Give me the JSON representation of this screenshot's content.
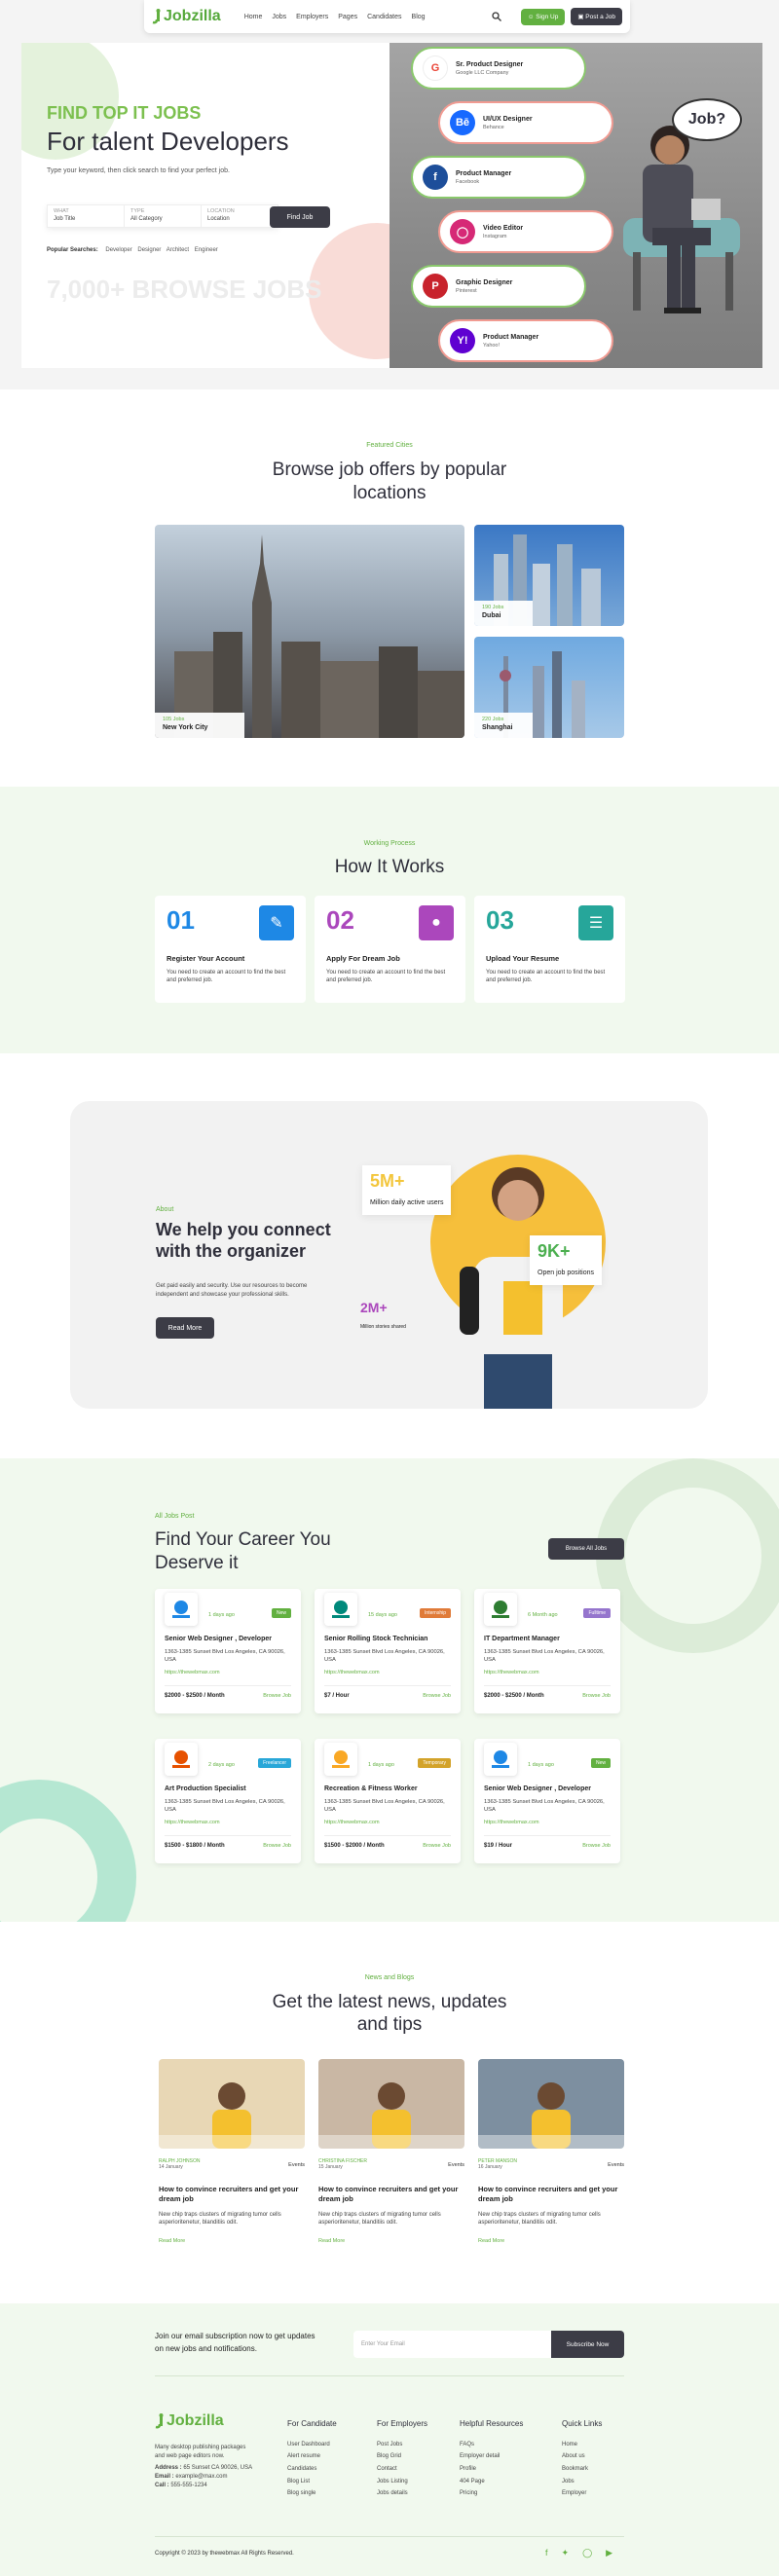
{
  "nav": {
    "logo": "Jobzilla",
    "menu": [
      "Home",
      "Jobs",
      "Employers",
      "Pages",
      "Candidates",
      "Blog"
    ],
    "signup": "Sign Up",
    "post_job": "Post a Job"
  },
  "hero": {
    "kicker": "FIND TOP IT JOBS",
    "title": "For talent Developers",
    "subtitle": "Type your keyword, then click search to find your perfect job.",
    "search": {
      "what_label": "WHAT",
      "what_value": "Job Title",
      "type_label": "TYPE",
      "type_value": "All Category",
      "location_label": "LOCATION",
      "location_value": "Location",
      "button": "Find Job"
    },
    "popular_label": "Popular Searches:",
    "popular": [
      "Developer",
      "Designer",
      "Architect",
      "Engineer"
    ],
    "browse": "7,000+ BROWSE JOBS",
    "bubble": "Job?",
    "cards": [
      {
        "title": "Sr. Product Designer",
        "company": "Google LLC Company",
        "color": "#ffffff"
      },
      {
        "title": "UI/UX Designer",
        "company": "Behance",
        "color": "#1769ff"
      },
      {
        "title": "Product Manager",
        "company": "Facebook",
        "color": "#1d4e9a"
      },
      {
        "title": "Video Editor",
        "company": "Instagram",
        "color": "#d62976"
      },
      {
        "title": "Graphic Designer",
        "company": "Pinterest",
        "color": "#c8232c"
      },
      {
        "title": "Product Manager",
        "company": "Yahoo!",
        "color": "#5f01d1"
      }
    ]
  },
  "cities": {
    "kicker": "Featured Cities",
    "title_l1": "Browse job offers by popular",
    "title_l2": "locations",
    "items": [
      {
        "count": "105 Jobs",
        "name": "New York City"
      },
      {
        "count": "190 Jobs",
        "name": "Dubai"
      },
      {
        "count": "220 Jobs",
        "name": "Shanghai"
      }
    ]
  },
  "how": {
    "kicker": "Working Process",
    "title": "How It Works",
    "steps": [
      {
        "num": "01",
        "title": "Register Your Account",
        "desc": "You need to create an account to find the best and preferred job.",
        "color": "#1e88e5"
      },
      {
        "num": "02",
        "title": "Apply For Dream Job",
        "desc": "You need to create an account to find the best and preferred job.",
        "color": "#ab47bc"
      },
      {
        "num": "03",
        "title": "Upload Your Resume",
        "desc": "You need to create an account to find the best and preferred job.",
        "color": "#26a69a"
      }
    ]
  },
  "about": {
    "kicker": "About",
    "title_l1": "We help you connect",
    "title_l2": "with the organizer",
    "desc_l1": "Get paid easily and security. Use our resources to become",
    "desc_l2": "independent and showcase your professional skills.",
    "button": "Read More",
    "stats": [
      {
        "value": "5M+",
        "label": "Million daily active users"
      },
      {
        "value": "9K+",
        "label": "Open job positions"
      },
      {
        "value": "2M+",
        "label": "Million stories shared"
      }
    ]
  },
  "career": {
    "kicker": "All Jobs Post",
    "title_l1": "Find Your Career You",
    "title_l2": "Deserve it",
    "browse_all": "Browse All Jobs",
    "jobs": [
      {
        "date": "1 days ago",
        "tag": "New",
        "tag_color": "#62b040",
        "title": "Senior Web Designer , Developer",
        "address": "1363-1385 Sunset Blvd Los Angeles, CA 90026, USA",
        "link": "https://thewebmax.com",
        "price": "$2000 - $2500 / Month",
        "logo_color": "#1e88e5",
        "logo_text": "COMPANY"
      },
      {
        "date": "15 days ago",
        "tag": "Internship",
        "tag_color": "#e07b39",
        "title": "Senior Rolling Stock Technician",
        "address": "1363-1385 Sunset Blvd Los Angeles, CA 90026, USA",
        "link": "https://thewebmax.com",
        "price": "$7 / Hour",
        "logo_color": "#00897b",
        "logo_text": "BUSINESS"
      },
      {
        "date": "6 Month ago",
        "tag": "Fulltime",
        "tag_color": "#9575cd",
        "title": "IT Department Manager",
        "address": "1363-1385 Sunset Blvd Los Angeles, CA 90026, USA",
        "link": "https://thewebmax.com",
        "price": "$2000 - $2500 / Month",
        "logo_color": "#2e7d32",
        "logo_text": "FASHION"
      },
      {
        "date": "2 days ago",
        "tag": "Freelancer",
        "tag_color": "#29a7d8",
        "title": "Art Production Specialist",
        "address": "1363-1385 Sunset Blvd Los Angeles, CA 90026, USA",
        "link": "https://thewebmax.com",
        "price": "$1500 - $1800 / Month",
        "logo_color": "#e65100",
        "logo_text": "ARROW"
      },
      {
        "date": "1 days ago",
        "tag": "Temporary",
        "tag_color": "#d3a32a",
        "title": "Recreation & Fitness Worker",
        "address": "1363-1385 Sunset Blvd Los Angeles, CA 90026, USA",
        "link": "https://thewebmax.com",
        "price": "$1500 - $2000 / Month",
        "logo_color": "#f9a825",
        "logo_text": "MEDIA"
      },
      {
        "date": "1 days ago",
        "tag": "New",
        "tag_color": "#62b040",
        "title": "Senior Web Designer , Developer",
        "address": "1363-1385 Sunset Blvd Los Angeles, CA 90026, USA",
        "link": "https://thewebmax.com",
        "price": "$19 / Hour",
        "logo_color": "#1e88e5",
        "logo_text": "COMPANY"
      }
    ],
    "browse_job": "Browse Job"
  },
  "blog": {
    "kicker": "News and Blogs",
    "title_l1": "Get the latest news, updates",
    "title_l2": "and tips",
    "posts": [
      {
        "author": "RALPH JOHNSON",
        "date": "14 January",
        "category": "Events",
        "title": "How to convince recruiters and get your dream job",
        "desc": "New chip traps clusters of migrating tumor cells asperioritenetur, blanditiis odit.",
        "read": "Read More",
        "color": "#e8d7b5"
      },
      {
        "author": "CHRISTINA FISCHER",
        "date": "15 January",
        "category": "Events",
        "title": "How to convince recruiters and get your dream job",
        "desc": "New chip traps clusters of migrating tumor cells asperioritenetur, blanditiis odit.",
        "read": "Read More",
        "color": "#c9b7a4"
      },
      {
        "author": "PETER MANSON",
        "date": "16 January",
        "category": "Events",
        "title": "How to convince recruiters and get your dream job",
        "desc": "New chip traps clusters of migrating tumor cells asperioritenetur, blanditiis odit.",
        "read": "Read More",
        "color": "#7d8fa0"
      }
    ]
  },
  "footer": {
    "newsletter_l1": "Join our email subscription now to get updates",
    "newsletter_l2": "on new jobs and notifications.",
    "email_placeholder": "Enter Your Email",
    "subscribe": "Subscribe Now",
    "logo": "Jobzilla",
    "about_l1": "Many desktop publishing packages",
    "about_l2": "and web page editors now.",
    "address_label": "Address :",
    "address": "65 Sunset CA 90026, USA",
    "email_label": "Email :",
    "email": "example@max.com",
    "call_label": "Call :",
    "call": "555-555-1234",
    "cols": [
      {
        "title": "For Candidate",
        "items": [
          "User Dashboard",
          "Alert resume",
          "Candidates",
          "Blog List",
          "Blog single"
        ]
      },
      {
        "title": "For Employers",
        "items": [
          "Post Jobs",
          "Blog Grid",
          "Contact",
          "Jobs Listing",
          "Jobs details"
        ]
      },
      {
        "title": "Helpful Resources",
        "items": [
          "FAQs",
          "Employer detail",
          "Profile",
          "404 Page",
          "Pricing"
        ]
      },
      {
        "title": "Quick Links",
        "items": [
          "Home",
          "About us",
          "Bookmark",
          "Jobs",
          "Employer"
        ]
      }
    ],
    "copyright": "Copyright © 2023 by thewebmax All Rights Reserved."
  }
}
